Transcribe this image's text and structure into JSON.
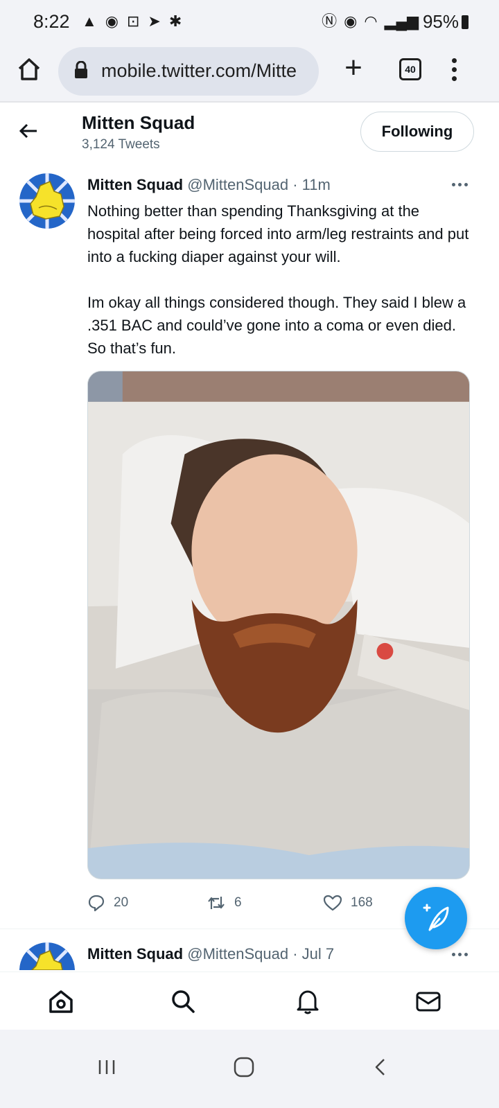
{
  "status_bar": {
    "time": "8:22",
    "battery": "95%"
  },
  "browser": {
    "url": "mobile.twitter.com/Mitte",
    "tab_count": "40"
  },
  "header": {
    "profile_name": "Mitten Squad",
    "tweet_count": "3,124 Tweets",
    "following_label": "Following"
  },
  "tweets": [
    {
      "name": "Mitten Squad",
      "handle": "@MittenSquad",
      "time": "· 11m",
      "paragraphs": [
        "Nothing better than spending Thanksgiving at the hospital after being forced into arm/leg restraints and put into a fucking diaper against your will.",
        "Im okay all things considered though. They said I blew a .351 BAC and could’ve gone into a coma or even died. So that’s fun."
      ],
      "replies": "20",
      "retweets": "6",
      "likes": "168"
    },
    {
      "name": "Mitten Squad",
      "handle": "@MittenSquad",
      "time": "· Jul 7"
    }
  ],
  "colors": {
    "accent": "#1d9bf0",
    "text": "#0f1419",
    "secondary": "#536471"
  }
}
